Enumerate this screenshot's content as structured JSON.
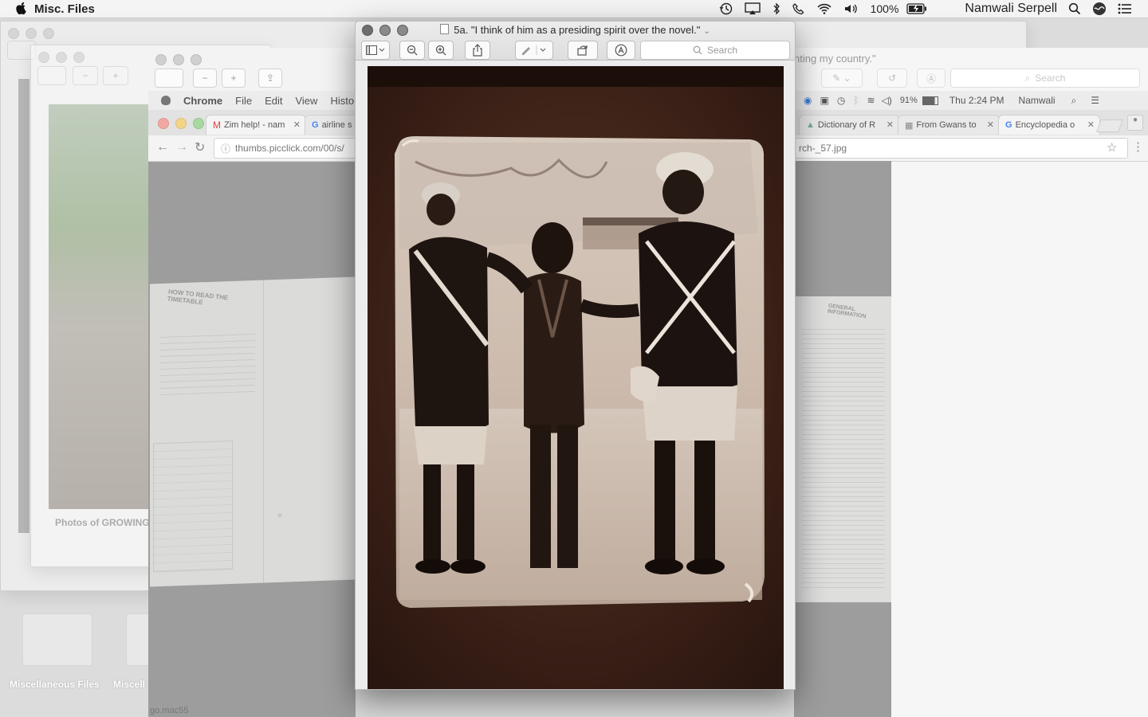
{
  "menubar": {
    "app_name": "Misc. Files",
    "battery": "100%",
    "user": "Namwali Serpell"
  },
  "finder": {
    "items": [
      {
        "label": "Miscellaneous Files"
      },
      {
        "label": "Miscell"
      }
    ],
    "photo_caption": "Photos of GROWING"
  },
  "chrome": {
    "menu": [
      "Chrome",
      "File",
      "Edit",
      "View",
      "Histo"
    ],
    "tabs_left": [
      {
        "label": "Zim help! - nam"
      },
      {
        "label": "airline s"
      }
    ],
    "tabs_right": [
      {
        "label": "Dictionary of R"
      },
      {
        "label": "From Gwans to"
      },
      {
        "label": "Encyclopedia o"
      }
    ],
    "url_left": "thumbs.picclick.com/00/s/",
    "url_right": "rch-_57.jpg",
    "inner_status": {
      "battery": "91%",
      "clock": "Thu 2:24 PM",
      "user": "Namwali"
    },
    "footer_text": "go.mac55",
    "timetable_heading": "HOW TO READ THE TIMETABLE",
    "right_doc_heading": "GENERAL INFORMATION"
  },
  "background_preview": {
    "title_fragment": "nting my country.\"",
    "search_placeholder": "Search"
  },
  "preview": {
    "title": "5a. \"I think of him as a presiding spirit over the novel.\"",
    "search_placeholder": "Search"
  }
}
